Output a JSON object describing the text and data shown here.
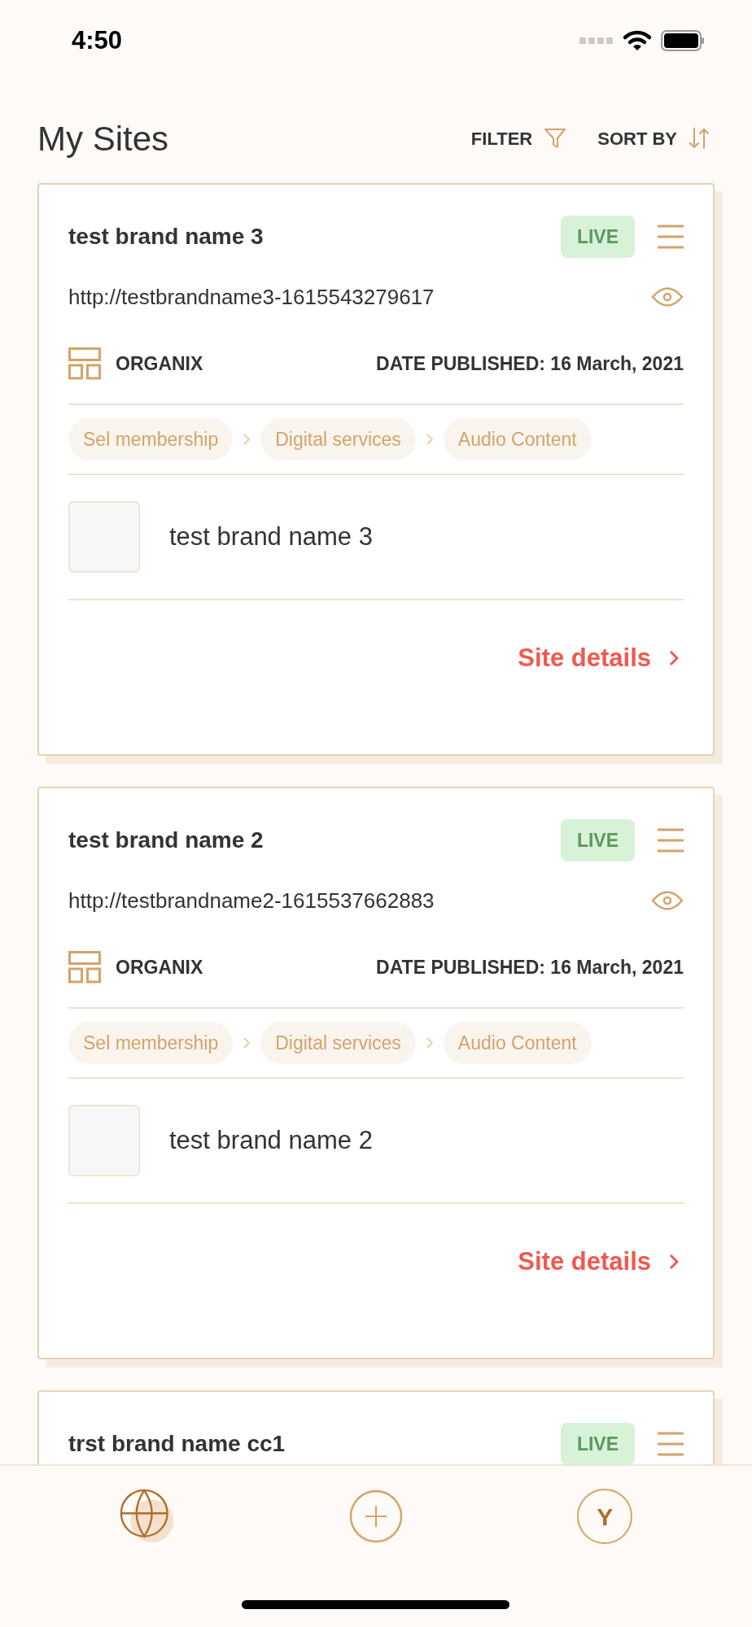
{
  "status_bar": {
    "time": "4:50"
  },
  "header": {
    "title": "My Sites",
    "filter": "FILTER",
    "sort": "SORT BY"
  },
  "sites": [
    {
      "name": "test brand name 3",
      "status": "LIVE",
      "url": "http://testbrandname3-1615543279617",
      "template": "ORGANIX",
      "date": "DATE PUBLISHED: 16 March, 2021",
      "categories": [
        "Sel membership",
        "Digital services",
        "Audio Content"
      ],
      "brand": "test brand name 3",
      "link": "Site details"
    },
    {
      "name": "test brand name 2",
      "status": "LIVE",
      "url": "http://testbrandname2-1615537662883",
      "template": "ORGANIX",
      "date": "DATE PUBLISHED: 16 March, 2021",
      "categories": [
        "Sel membership",
        "Digital services",
        "Audio Content"
      ],
      "brand": "test brand name 2",
      "link": "Site details"
    },
    {
      "name": "trst brand name cc1",
      "status": "LIVE"
    }
  ],
  "nav": [
    {
      "kind": "globe",
      "selected": true
    },
    {
      "kind": "add",
      "selected": false
    },
    {
      "kind": "avatar",
      "label": "Y",
      "selected": false
    }
  ]
}
